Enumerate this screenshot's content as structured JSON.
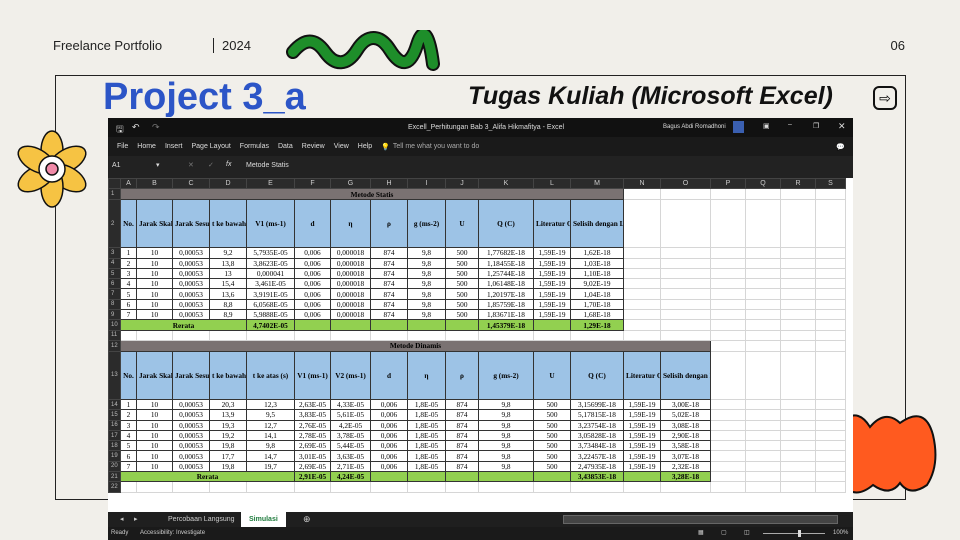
{
  "page": {
    "left": "Freelance Portfolio",
    "year": "2024",
    "number": "06",
    "title": "Project 3_a",
    "subtitle": "Tugas Kuliah (Microsoft Excel)"
  },
  "excel": {
    "window_title": "Excell_Perhitungan Bab 3_Alifa Hikmafitya  -  Excel",
    "user": "Bagus Abdi Romadhoni",
    "menu": [
      "File",
      "Home",
      "Insert",
      "Page Layout",
      "Formulas",
      "Data",
      "Review",
      "View",
      "Help"
    ],
    "tell_me": "Tell me what you want to do",
    "name_box": "A1",
    "formula": "Metode Statis",
    "columns": [
      "A",
      "B",
      "C",
      "D",
      "E",
      "F",
      "G",
      "H",
      "I",
      "J",
      "K",
      "L",
      "M",
      "N",
      "O",
      "P",
      "Q",
      "R",
      "S"
    ],
    "sheet_tabs": [
      "Percobaan Langsung",
      "Simulasi"
    ],
    "active_sheet": "Simulasi",
    "status": "Ready",
    "accessibility": "Accessibility: Investigate",
    "zoom": "100%"
  },
  "statis": {
    "title": "Metode Statis",
    "headers": [
      "No.",
      "Jarak Skala Mikroskop (x)",
      "Jarak Sesungguhnya (m)",
      "t ke bawah (s)",
      "V1 (ms-1)",
      "d",
      "η",
      "ρ",
      "g (ms-2)",
      "U",
      "Q (C)",
      "Literatur Q (C)",
      "Selisih dengan Literatur"
    ],
    "rows": [
      [
        "1",
        "10",
        "0,00053",
        "9,2",
        "5,7935E-05",
        "0,006",
        "0,000018",
        "874",
        "9,8",
        "500",
        "1,77682E-18",
        "1,59E-19",
        "1,62E-18"
      ],
      [
        "2",
        "10",
        "0,00053",
        "13,8",
        "3,8623E-05",
        "0,006",
        "0,000018",
        "874",
        "9,8",
        "500",
        "1,18455E-18",
        "1,59E-19",
        "1,03E-18"
      ],
      [
        "3",
        "10",
        "0,00053",
        "13",
        "0,000041",
        "0,006",
        "0,000018",
        "874",
        "9,8",
        "500",
        "1,25744E-18",
        "1,59E-19",
        "1,10E-18"
      ],
      [
        "4",
        "10",
        "0,00053",
        "15,4",
        "3,461E-05",
        "0,006",
        "0,000018",
        "874",
        "9,8",
        "500",
        "1,06148E-18",
        "1,59E-19",
        "9,02E-19"
      ],
      [
        "5",
        "10",
        "0,00053",
        "13,6",
        "3,9191E-05",
        "0,006",
        "0,000018",
        "874",
        "9,8",
        "500",
        "1,20197E-18",
        "1,59E-19",
        "1,04E-18"
      ],
      [
        "6",
        "10",
        "0,00053",
        "8,8",
        "6,0568E-05",
        "0,006",
        "0,000018",
        "874",
        "9,8",
        "500",
        "1,85759E-18",
        "1,59E-19",
        "1,70E-18"
      ],
      [
        "7",
        "10",
        "0,00053",
        "8,9",
        "5,9888E-05",
        "0,006",
        "0,000018",
        "874",
        "9,8",
        "500",
        "1,83671E-18",
        "1,59E-19",
        "1,68E-18"
      ]
    ],
    "avg_label": "Rerata",
    "avg_v1": "4,7402E-05",
    "avg_q": "1,45379E-18",
    "avg_selisih": "1,29E-18"
  },
  "dinamis": {
    "title": "Metode Dinamis",
    "headers": [
      "No.",
      "Jarak Skala Mikroskop (x)",
      "Jarak Sesungguhnya (m)",
      "t ke bawah (s)",
      "t ke atas (s)",
      "V1 (ms-1)",
      "V2 (ms-1)",
      "d",
      "η",
      "ρ",
      "g (ms-2)",
      "U",
      "Q (C)",
      "Literatur Q (C)",
      "Selisih dengan Literatur"
    ],
    "rows": [
      [
        "1",
        "10",
        "0,00053",
        "20,3",
        "12,3",
        "2,63E-05",
        "4,33E-05",
        "0,006",
        "1,8E-05",
        "874",
        "9,8",
        "500",
        "3,15699E-18",
        "1,59E-19",
        "3,00E-18"
      ],
      [
        "2",
        "10",
        "0,00053",
        "13,9",
        "9,5",
        "3,83E-05",
        "5,61E-05",
        "0,006",
        "1,8E-05",
        "874",
        "9,8",
        "500",
        "5,17815E-18",
        "1,59E-19",
        "5,02E-18"
      ],
      [
        "3",
        "10",
        "0,00053",
        "19,3",
        "12,7",
        "2,76E-05",
        "4,2E-05",
        "0,006",
        "1,8E-05",
        "874",
        "9,8",
        "500",
        "3,23754E-18",
        "1,59E-19",
        "3,08E-18"
      ],
      [
        "4",
        "10",
        "0,00053",
        "19,2",
        "14,1",
        "2,78E-05",
        "3,78E-05",
        "0,006",
        "1,8E-05",
        "874",
        "9,8",
        "500",
        "3,05828E-18",
        "1,59E-19",
        "2,90E-18"
      ],
      [
        "5",
        "10",
        "0,00053",
        "19,8",
        "9,8",
        "2,69E-05",
        "5,44E-05",
        "0,006",
        "1,8E-05",
        "874",
        "9,8",
        "500",
        "3,73484E-18",
        "1,59E-19",
        "3,58E-18"
      ],
      [
        "6",
        "10",
        "0,00053",
        "17,7",
        "14,7",
        "3,01E-05",
        "3,63E-05",
        "0,006",
        "1,8E-05",
        "874",
        "9,8",
        "500",
        "3,22457E-18",
        "1,59E-19",
        "3,07E-18"
      ],
      [
        "7",
        "10",
        "0,00053",
        "19,8",
        "19,7",
        "2,69E-05",
        "2,71E-05",
        "0,006",
        "1,8E-05",
        "874",
        "9,8",
        "500",
        "2,47935E-18",
        "1,59E-19",
        "2,32E-18"
      ]
    ],
    "avg_label": "Rerata",
    "avg_v1": "2,91E-05",
    "avg_v2": "4,24E-05",
    "avg_q": "3,43853E-18",
    "avg_selisih": "3,28E-18"
  }
}
